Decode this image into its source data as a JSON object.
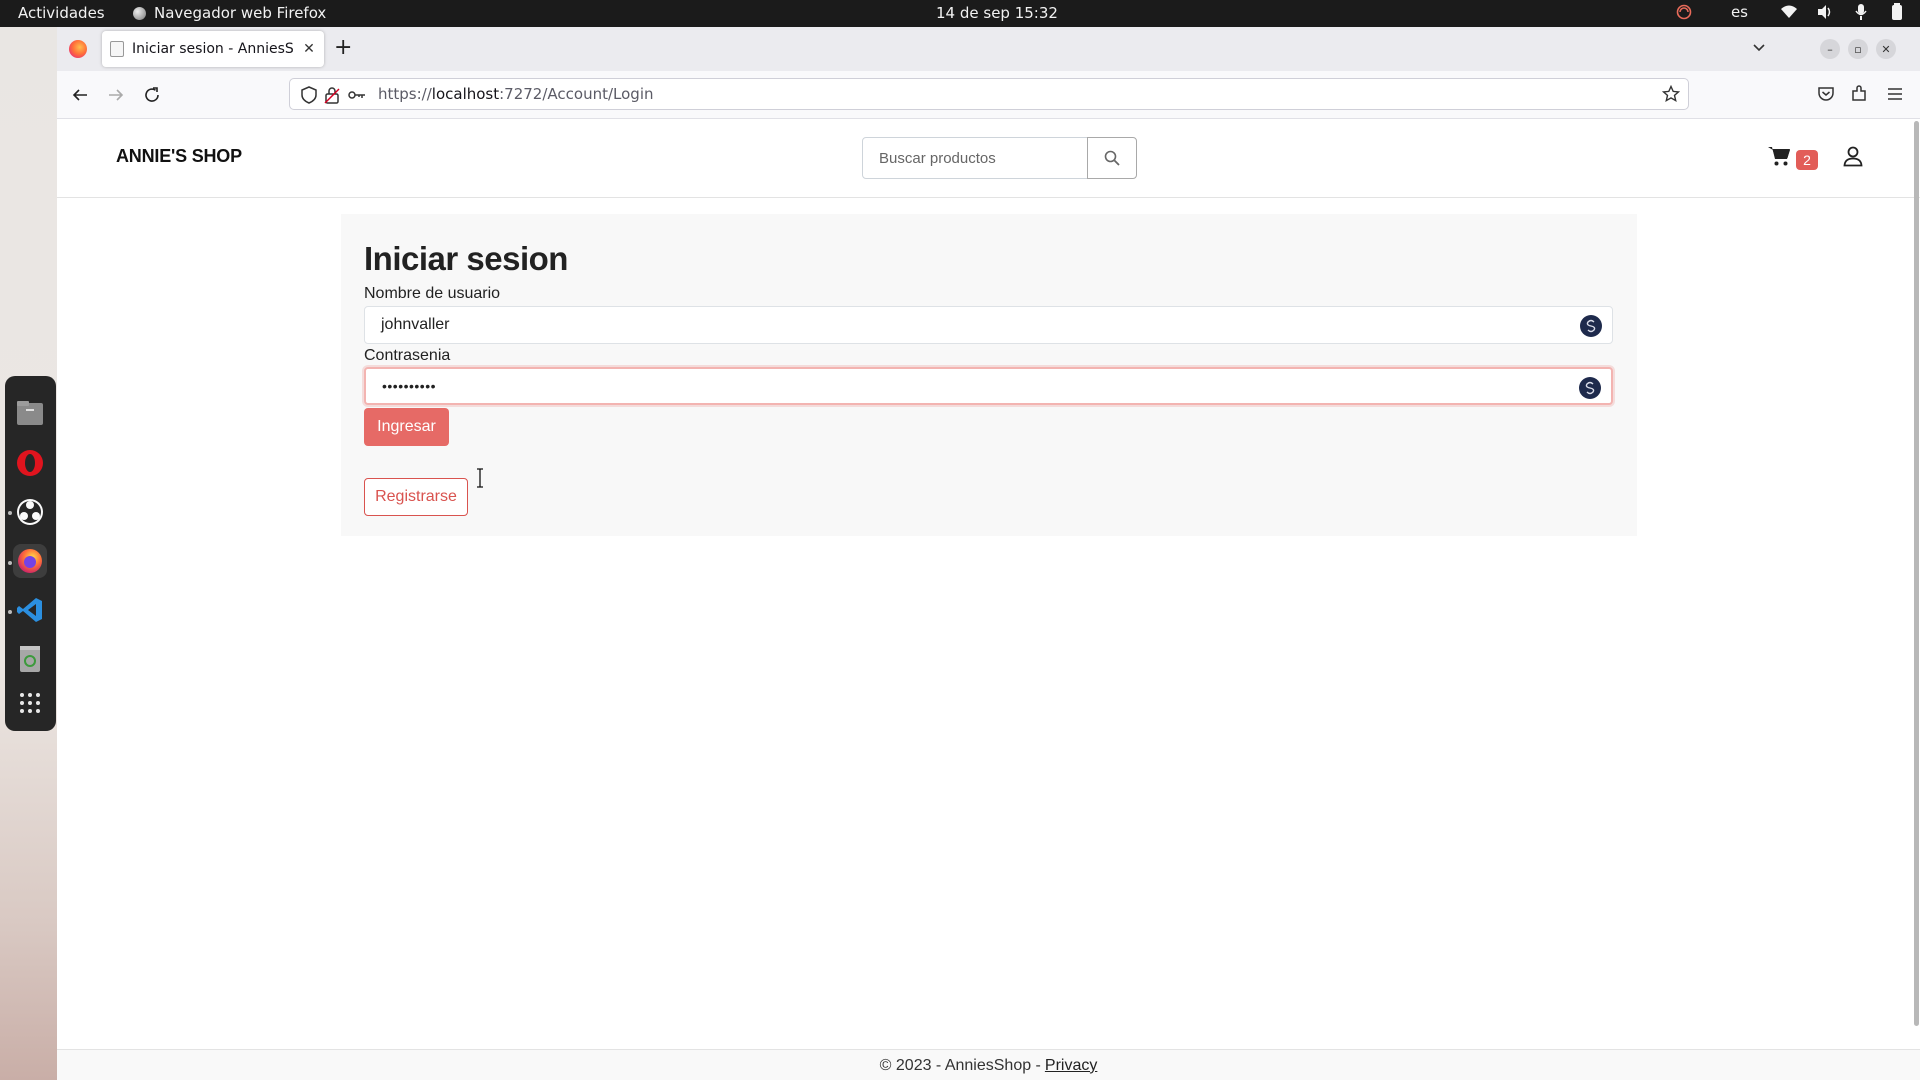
{
  "system": {
    "activities": "Actividades",
    "app_name": "Navegador web Firefox",
    "clock": "14 de sep  15:32",
    "language": "es"
  },
  "browser": {
    "tab_title": "Iniciar sesion - AnniesShop",
    "url_prefix": "https://",
    "url_host": "localhost",
    "url_rest": ":7272/Account/Login"
  },
  "site": {
    "brand": "ANNIE'S SHOP",
    "search_placeholder": "Buscar productos",
    "cart_count": "2"
  },
  "login": {
    "title": "Iniciar sesion",
    "username_label": "Nombre de usuario",
    "username_value": "johnvaller",
    "password_label": "Contrasenia",
    "password_masked": "••••••••••",
    "submit_label": "Ingresar",
    "register_label": "Registrarse"
  },
  "footer": {
    "copyright": "© 2023 - AnniesShop -",
    "privacy_link": "Privacy"
  },
  "colors": {
    "accent": "#e66a66",
    "accent_border": "#d9534f",
    "badge": "#e25d58"
  }
}
